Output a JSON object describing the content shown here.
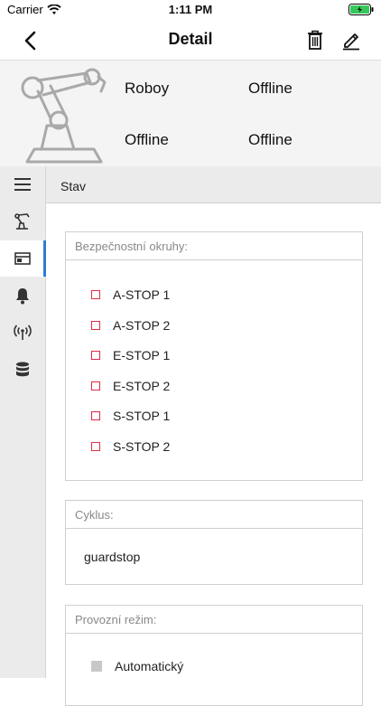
{
  "status_bar": {
    "carrier": "Carrier",
    "time": "1:11 PM"
  },
  "nav": {
    "title": "Detail"
  },
  "device": {
    "name": "Roboy",
    "status_1": "Offline",
    "status_2": "Offline",
    "status_3": "Offline"
  },
  "sidebar": {
    "items": [
      {
        "icon": "menu-icon"
      },
      {
        "icon": "robot-icon"
      },
      {
        "icon": "window-icon",
        "active": true
      },
      {
        "icon": "bell-icon"
      },
      {
        "icon": "antenna-icon"
      },
      {
        "icon": "database-icon"
      }
    ]
  },
  "section": {
    "title": "Stav"
  },
  "safety": {
    "title": "Bezpečnostní okruhy:",
    "items": [
      "A-STOP 1",
      "A-STOP 2",
      "E-STOP 1",
      "E-STOP 2",
      "S-STOP 1",
      "S-STOP 2"
    ]
  },
  "cycle": {
    "title": "Cyklus:",
    "value": "guardstop"
  },
  "mode": {
    "title": "Provozní režim:",
    "items": [
      "Automatický"
    ]
  },
  "colors": {
    "accent": "#2e7bd6",
    "alert": "#e0294a",
    "sidebar_bg": "#ebebeb",
    "header_bg": "#f4f4f4"
  }
}
